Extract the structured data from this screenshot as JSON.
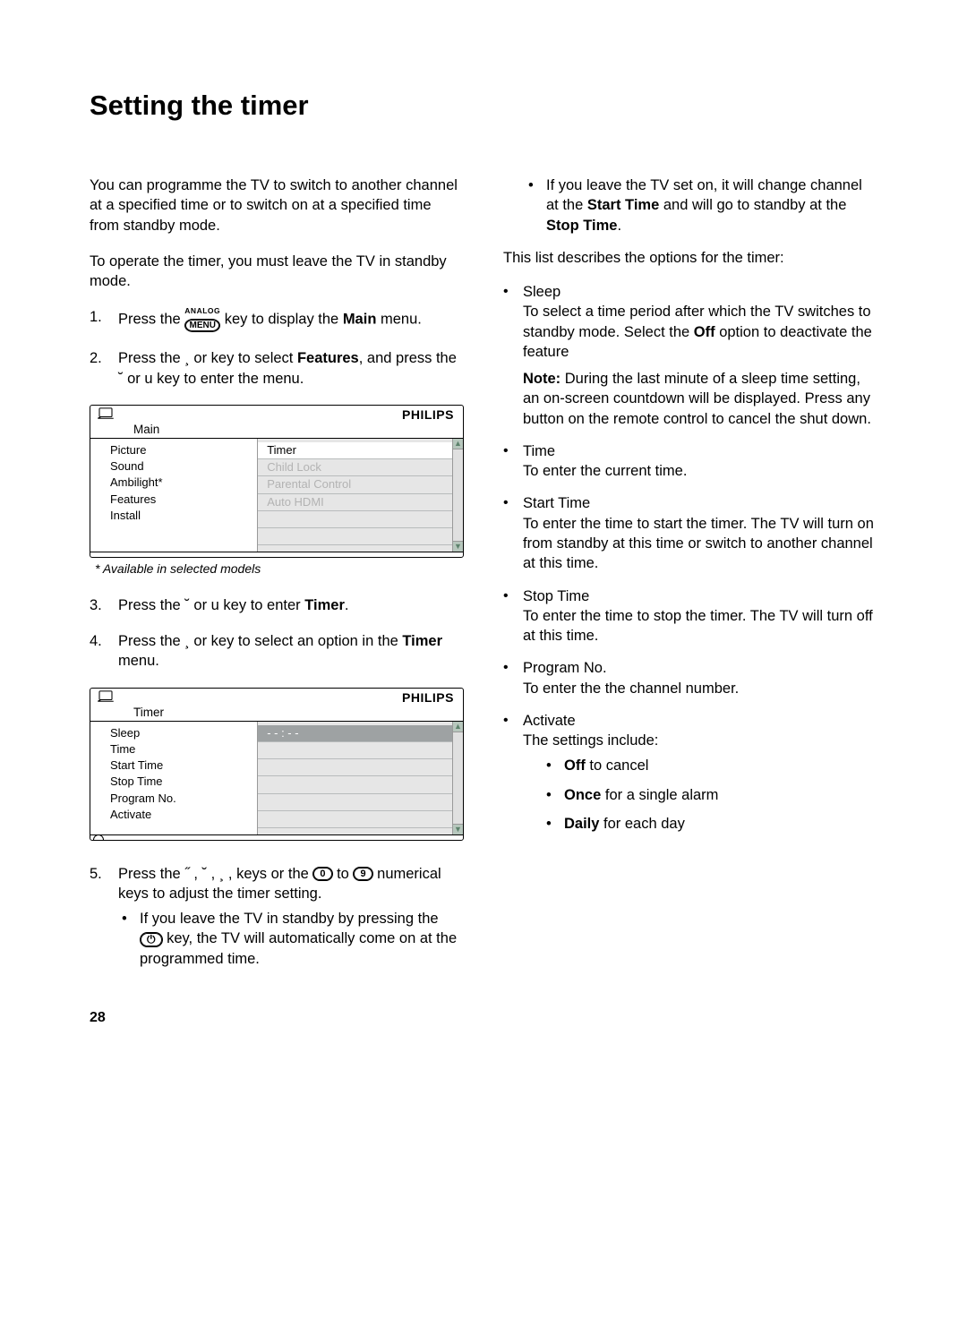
{
  "title": "Setting the timer",
  "intro1": "You can programme the TV to switch to another channel at a specified time or to switch on at a specified time from standby mode.",
  "intro2": "To operate the timer, you must leave the TV in standby mode.",
  "menuKey": {
    "top": "ANALOG",
    "main": "MENU"
  },
  "steps": {
    "s1": {
      "num": "1.",
      "pre": "Press the ",
      "post": " key to display the ",
      "bold": "Main",
      "tail": " menu."
    },
    "s2": {
      "num": "2.",
      "text_a": "Press the ",
      "key_a": " ¸ ",
      "text_b": " or ",
      "key_b": "   ",
      "text_c": " key to select ",
      "bold": "Features",
      "text_d": ", and press the ",
      "key_c": " ˘ ",
      "text_e": " or ",
      "key_d": "u",
      "text_f": "  key to enter the menu."
    },
    "s3": {
      "num": "3.",
      "text_a": "Press the ",
      "key_a": " ˘ ",
      "text_b": " or ",
      "key_b": "u",
      "text_c": "  key to enter ",
      "bold": "Timer",
      "tail": "."
    },
    "s4": {
      "num": "4.",
      "text_a": "Press the ",
      "key_a": " ¸ ",
      "text_b": " or ",
      "key_b": "   ",
      "text_c": " key to select an option in the ",
      "bold": "Timer",
      "tail": " menu."
    },
    "s5": {
      "num": "5.",
      "text_a": "Press the  ",
      "k1": "˝",
      "sep": " ,  ",
      "k2": "˘",
      "k3": "¸",
      "k4": " ",
      "text_b": "   keys or the ",
      "key0": "0",
      "text_c": " to ",
      "key9": "9",
      "text_d": " numerical keys to adjust the timer setting."
    }
  },
  "s5sub": {
    "a": {
      "pre": "If you leave the TV in standby by pressing the ",
      "post": " key, the TV will automatically come on at the programmed time."
    },
    "b": {
      "pre": "If you leave the TV set on, it will change channel at the ",
      "b1": "Start Time",
      "mid": " and will go to standby at the ",
      "b2": "Stop Time",
      "tail": "."
    }
  },
  "osd1": {
    "brand": "PHILIPS",
    "title": "Main",
    "left": [
      "Picture",
      "Sound",
      "Ambilight*",
      "Features",
      "Install"
    ],
    "right": [
      "Timer",
      "Child Lock",
      "Parental Control",
      "Auto HDMI"
    ]
  },
  "footnote": "* Available in selected models",
  "osd2": {
    "brand": "PHILIPS",
    "title": "Timer",
    "left": [
      "Sleep",
      "Time",
      "Start Time",
      "Stop Time",
      "Program No.",
      "Activate"
    ],
    "rightSel": "- - : - -"
  },
  "optionsIntro": "This list describes the options for the timer:",
  "options": {
    "sleep": {
      "head": "Sleep",
      "body_a": "To select a time period after which the TV switches to standby mode. Select the ",
      "bold": "Off",
      "body_b": " option to deactivate the feature",
      "note_label": "Note:",
      "note_body": " During the last minute of a sleep time setting, an on-screen countdown will be displayed. Press any button on the remote control to cancel the shut down."
    },
    "time": {
      "head": "Time",
      "body": "To enter the current time."
    },
    "start": {
      "head": "Start Time",
      "body": "To enter the time to start the timer. The TV will turn on from standby at this time or switch to another channel at this time."
    },
    "stop": {
      "head": "Stop Time",
      "body": "To enter the time to stop the timer. The TV will turn off at this time."
    },
    "prog": {
      "head": "Program No.",
      "body": "To enter the the channel number."
    },
    "activate": {
      "head": "Activate",
      "body": "The settings include:",
      "items": {
        "off": {
          "b": "Off",
          "t": " to cancel"
        },
        "once": {
          "b": "Once",
          "t": " for a single alarm"
        },
        "daily": {
          "b": "Daily",
          "t": " for each day"
        }
      }
    }
  },
  "pageNumber": "28"
}
